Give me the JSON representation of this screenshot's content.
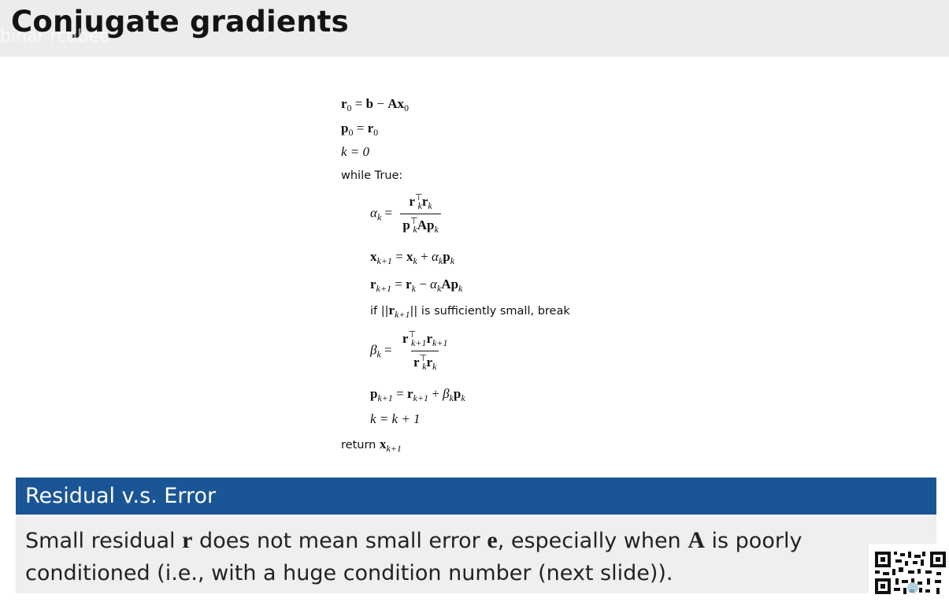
{
  "slide": {
    "title": "Conjugate gradients",
    "watermark": "binar  rcubee"
  },
  "algorithm": {
    "init": {
      "r0_lhs": "r",
      "r0_lhs_sub": "0",
      "r0_rhs_b": "b",
      "r0_minus": " − ",
      "r0_rhs_A": "Ax",
      "r0_rhs_sub": "0",
      "p0_lhs": "p",
      "p0_lhs_sub": "0",
      "p0_rhs": "r",
      "p0_rhs_sub": "0",
      "k_line": "k = 0"
    },
    "while_line": "while True:",
    "alpha": {
      "lhs": "α",
      "lhs_sub": "k",
      "num_a": "r",
      "num_a_sub": "k",
      "num_a_sup": "⊤",
      "num_b": "r",
      "num_b_sub": "k",
      "den_a": "p",
      "den_a_sub": "k",
      "den_a_sup": "⊤",
      "den_b": "Ap",
      "den_b_sub": "k"
    },
    "x_update": {
      "lhs": "x",
      "lhs_sub": "k+1",
      "rhs_x": "x",
      "rhs_x_sub": "k",
      "plus": " + ",
      "rhs_alpha": "α",
      "rhs_alpha_sub": "k",
      "rhs_p": "p",
      "rhs_p_sub": "k"
    },
    "r_update": {
      "lhs": "r",
      "lhs_sub": "k+1",
      "rhs_r": "r",
      "rhs_r_sub": "k",
      "minus": " − ",
      "rhs_alpha": "α",
      "rhs_alpha_sub": "k",
      "rhs_Ap": "Ap",
      "rhs_Ap_sub": "k"
    },
    "break_line": {
      "pre": "if ||",
      "r": "r",
      "r_sub": "k+1",
      "post": "|| is sufficiently small, break"
    },
    "beta": {
      "lhs": "β",
      "lhs_sub": "k",
      "num_a": "r",
      "num_a_sub": "k+1",
      "num_a_sup": "⊤",
      "num_b": "r",
      "num_b_sub": "k+1",
      "den_a": "r",
      "den_a_sub": "k",
      "den_a_sup": "⊤",
      "den_b": "r",
      "den_b_sub": "k"
    },
    "p_update": {
      "lhs": "p",
      "lhs_sub": "k+1",
      "rhs_r": "r",
      "rhs_r_sub": "k+1",
      "plus": " + ",
      "rhs_beta": "β",
      "rhs_beta_sub": "k",
      "rhs_p": "p",
      "rhs_p_sub": "k"
    },
    "k_update": "k = k + 1",
    "return_line": {
      "pre": "return ",
      "x": "x",
      "x_sub": "k+1"
    }
  },
  "block": {
    "title": "Residual v.s. Error",
    "text_1": "Small residual ",
    "sym_r": "r",
    "text_2": " does not mean small error ",
    "sym_e": "e",
    "text_3": ", especially when ",
    "sym_A": "A",
    "text_4": " is poorly conditioned (i.e., with a huge condition number (next slide))."
  },
  "colors": {
    "title_bar": "#ececec",
    "block_header": "#1a5595",
    "block_body": "#efeff2"
  }
}
